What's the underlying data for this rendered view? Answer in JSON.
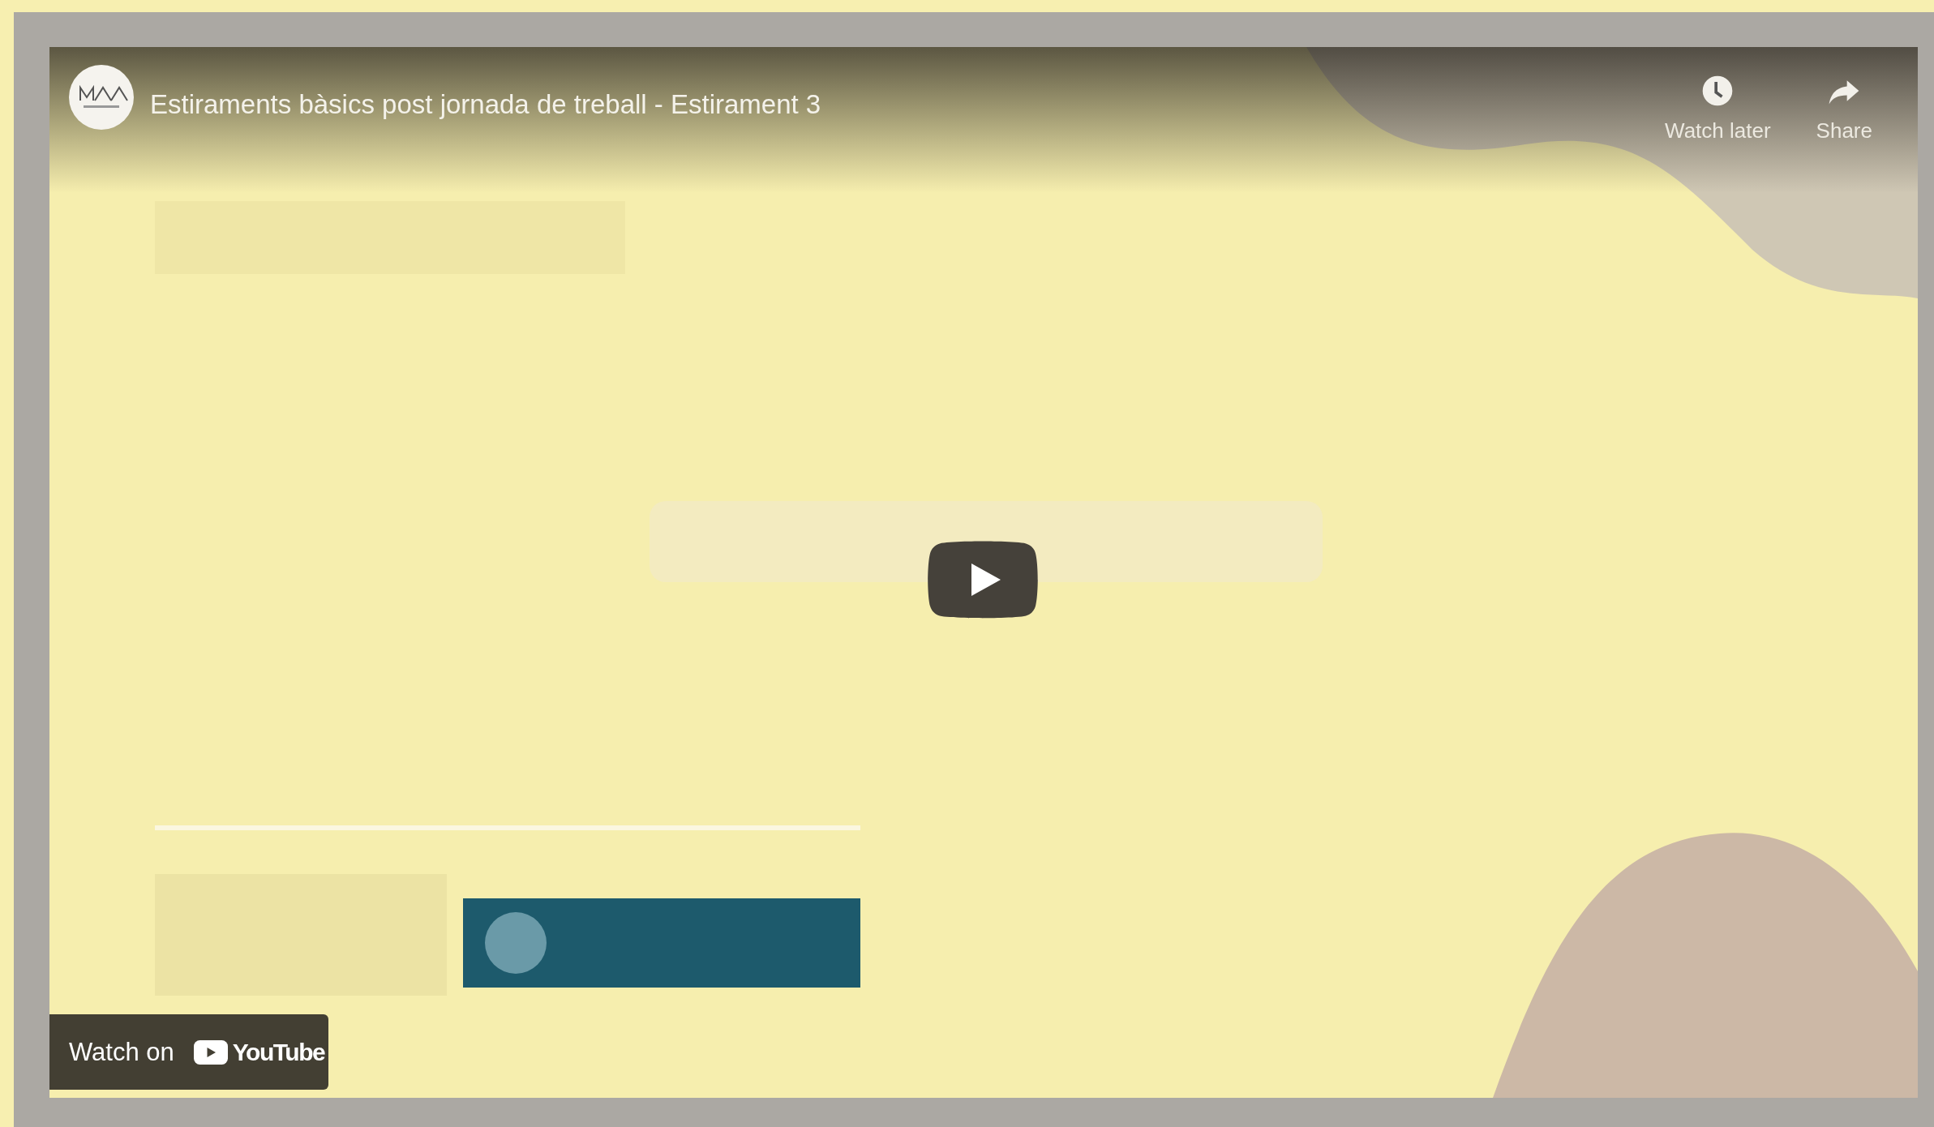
{
  "video": {
    "title": "Estiraments bàsics post jornada de treball - Estirament 3",
    "actions": [
      {
        "kind": "watch_later",
        "label": "Watch later"
      },
      {
        "kind": "share",
        "label": "Share"
      }
    ],
    "watch_on": {
      "label": "Watch on",
      "brand": "YouTube"
    }
  }
}
